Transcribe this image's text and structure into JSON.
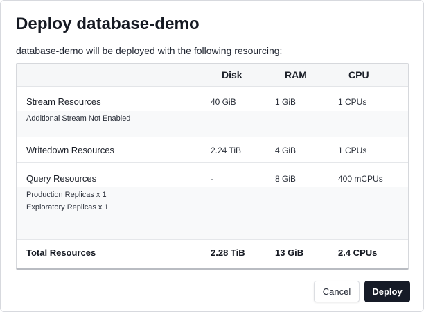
{
  "dialog": {
    "title": "Deploy database-demo",
    "subtitle": "database-demo will be deployed with the following resourcing:"
  },
  "table": {
    "headers": {
      "disk": "Disk",
      "ram": "RAM",
      "cpu": "CPU"
    },
    "rows": [
      {
        "label": "Stream Resources",
        "disk": "40 GiB",
        "ram": "1 GiB",
        "cpu": "1 CPUs",
        "notes": [
          "Additional Stream Not Enabled"
        ]
      },
      {
        "label": "Writedown Resources",
        "disk": "2.24 TiB",
        "ram": "4 GiB",
        "cpu": "1 CPUs",
        "notes": []
      },
      {
        "label": "Query Resources",
        "disk": "-",
        "ram": "8 GiB",
        "cpu": "400 mCPUs",
        "notes": [
          "Production Replicas x 1",
          "Exploratory Replicas x 1"
        ]
      }
    ],
    "total": {
      "label": "Total Resources",
      "disk": "2.28 TiB",
      "ram": "13 GiB",
      "cpu": "2.4 CPUs"
    }
  },
  "actions": {
    "cancel_label": "Cancel",
    "deploy_label": "Deploy"
  }
}
